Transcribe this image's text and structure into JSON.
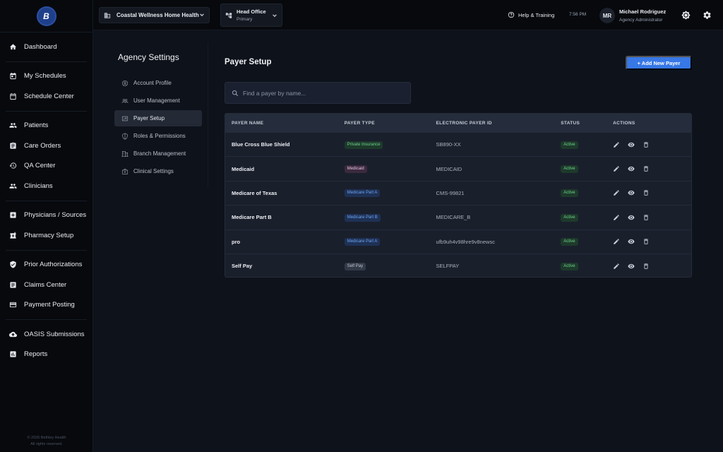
{
  "app": {
    "logo_text": "B"
  },
  "nav": {
    "groups": [
      [
        {
          "label": "Dashboard",
          "icon": "home-icon"
        }
      ],
      [
        {
          "label": "My Schedules",
          "icon": "calendar-check-icon"
        },
        {
          "label": "Schedule Center",
          "icon": "calendar-icon"
        }
      ],
      [
        {
          "label": "Patients",
          "icon": "people-icon"
        },
        {
          "label": "Care Orders",
          "icon": "clipboard-icon"
        },
        {
          "label": "QA Center",
          "icon": "history-icon"
        },
        {
          "label": "Clinicians",
          "icon": "group-icon"
        }
      ],
      [
        {
          "label": "Physicians / Sources",
          "icon": "medical-plus-icon"
        },
        {
          "label": "Pharmacy Setup",
          "icon": "pharmacy-icon"
        }
      ],
      [
        {
          "label": "Prior Authorizations",
          "icon": "shield-check-icon"
        },
        {
          "label": "Claims Center",
          "icon": "document-icon"
        },
        {
          "label": "Payment Posting",
          "icon": "credit-card-icon"
        }
      ],
      [
        {
          "label": "OASIS Submissions",
          "icon": "cloud-upload-icon"
        },
        {
          "label": "Reports",
          "icon": "bar-chart-icon"
        }
      ]
    ],
    "footer_line1": "© 2026 Bethley Health",
    "footer_line2": "All rights reserved."
  },
  "topbar": {
    "agency": "Coastal Wellness Home Health",
    "office_name": "Head Office",
    "office_sub": "Primary",
    "help": "Help & Training",
    "time": "7:56 PM",
    "avatar": "MR",
    "user_name": "Michael Rodriguez",
    "user_role": "Agency Administrator"
  },
  "settings": {
    "title": "Agency Settings",
    "items": [
      {
        "label": "Account Profile",
        "icon": "account-circle-icon",
        "active": false
      },
      {
        "label": "User Management",
        "icon": "users-icon",
        "active": false
      },
      {
        "label": "Payer Setup",
        "icon": "payer-card-icon",
        "active": true
      },
      {
        "label": "Roles & Permissions",
        "icon": "shield-lock-icon",
        "active": false
      },
      {
        "label": "Branch Management",
        "icon": "building-icon",
        "active": false
      },
      {
        "label": "Clinical Settings",
        "icon": "medical-bag-icon",
        "active": false
      }
    ]
  },
  "main": {
    "title": "Payer Setup",
    "add_button": "+ Add New Payer",
    "search_placeholder": "Find a payer by name...",
    "table": {
      "headers": [
        "PAYER NAME",
        "PAYER TYPE",
        "ELECTRONIC PAYER ID",
        "STATUS",
        "ACTIONS"
      ],
      "rows": [
        {
          "name": "Blue Cross Blue Shield",
          "type": "Private Insurance",
          "type_style": "green",
          "payer_id": "SB890-XX",
          "status": "Active"
        },
        {
          "name": "Medicaid",
          "type": "Medicaid",
          "type_style": "purple",
          "payer_id": "MEDICAID",
          "status": "Active"
        },
        {
          "name": "Medicare of Texas",
          "type": "Medicare Part A",
          "type_style": "blue",
          "payer_id": "CMS-99821",
          "status": "Active"
        },
        {
          "name": "Medicare Part B",
          "type": "Medicare Part B",
          "type_style": "blue",
          "payer_id": "MEDICARE_B",
          "status": "Active"
        },
        {
          "name": "pro",
          "type": "Medicare Part A",
          "type_style": "blue",
          "payer_id": "ufb9uh4v98hre9v8newsc",
          "status": "Active"
        },
        {
          "name": "Self Pay",
          "type": "Self Pay",
          "type_style": "gray",
          "payer_id": "SELFPAY",
          "status": "Active"
        }
      ]
    }
  },
  "colors": {
    "accent": "#3778e6",
    "background": "#0e121a",
    "nav_bg": "#07090d",
    "active_green": "#6fd08c"
  }
}
